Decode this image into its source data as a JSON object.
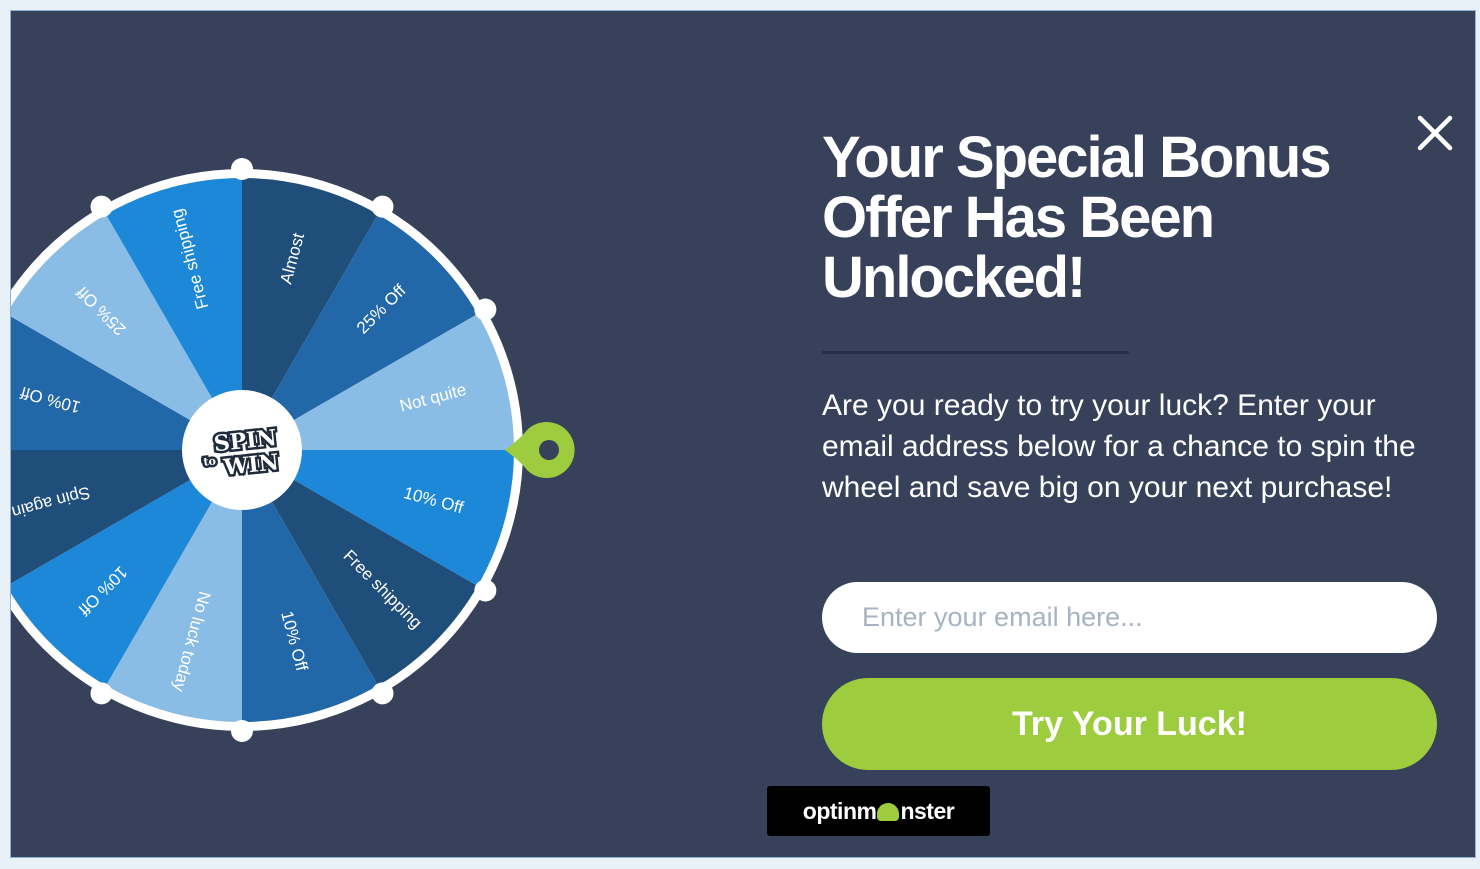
{
  "popup": {
    "headline": "Your Special Bonus Offer Has Been Unlocked!",
    "body": "Are you ready to try your luck? Enter your email address below for a chance to spin the wheel and save big on your next purchase!",
    "email_placeholder": "Enter your email here...",
    "cta_label": "Try Your Luck!",
    "close_icon": "close-icon"
  },
  "wheel": {
    "center_logo": {
      "line1": "SPIN",
      "small": "to",
      "line2": "WIN"
    },
    "segments": [
      {
        "label": "Almost",
        "color": "#1f4e7a"
      },
      {
        "label": "25% Off",
        "color": "#2268a8"
      },
      {
        "label": "Not quite",
        "color": "#8abde6"
      },
      {
        "label": "10% Off",
        "color": "#1d87d8"
      },
      {
        "label": "Free shipping",
        "color": "#1f4e7a"
      },
      {
        "label": "10% Off",
        "color": "#2268a8"
      },
      {
        "label": "No luck today",
        "color": "#8abde6"
      },
      {
        "label": "10% Off",
        "color": "#1d87d8"
      },
      {
        "label": "Spin again",
        "color": "#1f4e7a"
      },
      {
        "label": "10% Off",
        "color": "#2268a8"
      },
      {
        "label": "25% Off",
        "color": "#8abde6"
      },
      {
        "label": "Free shipping",
        "color": "#1d87d8"
      }
    ],
    "pointer_color": "#9dcc3f"
  },
  "branding": {
    "badge_left": "optinm",
    "badge_right": "nster",
    "mascot_icon": "monster-icon"
  },
  "colors": {
    "background": "#37415a",
    "cta": "#9dcc3f",
    "input_bg": "#ffffff",
    "text": "#ffffff"
  }
}
